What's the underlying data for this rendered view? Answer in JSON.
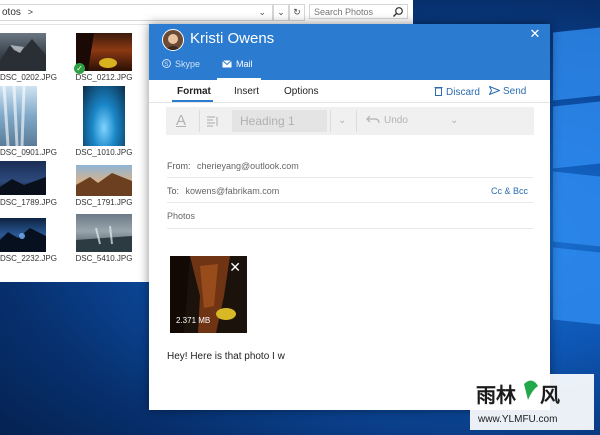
{
  "explorer": {
    "address_path": "otos",
    "search_placeholder": "Search Photos",
    "thumbnails": [
      {
        "label": "DSC_0202.JPG",
        "selected": false
      },
      {
        "label": "DSC_0212.JPG",
        "selected": true
      },
      {
        "label": "DSC_0901.JPG",
        "selected": false
      },
      {
        "label": "DSC_1010.JPG",
        "selected": false
      },
      {
        "label": "DSC_1789.JPG",
        "selected": false
      },
      {
        "label": "DSC_1791.JPG",
        "selected": false
      },
      {
        "label": "DSC_2232.JPG",
        "selected": false
      },
      {
        "label": "DSC_5410.JPG",
        "selected": false
      }
    ]
  },
  "mail": {
    "contact_name": "Kristi Owens",
    "tabs": [
      {
        "label": "Skype",
        "icon": "skype-icon"
      },
      {
        "label": "Mail",
        "icon": "mail-icon"
      }
    ],
    "ribbon_tabs": [
      "Format",
      "Insert",
      "Options"
    ],
    "discard_label": "Discard",
    "send_label": "Send",
    "toolbar": {
      "font_icon": "A",
      "style_value": "Heading 1",
      "undo_label": "Undo"
    },
    "from_label": "From:",
    "from_value": "cherieyang@outlook.com",
    "to_label": "To:",
    "to_value": "kowens@fabrikam.com",
    "cc_bcc_label": "Cc & Bcc",
    "subject": "Photos",
    "attachment_size": "2.371 MB",
    "body_text": "Hey! Here is that photo I w"
  },
  "watermark": {
    "text_cn": "雨林木风",
    "url": "www.YLMFU.com"
  },
  "colors": {
    "accent": "#2b7bd1",
    "desktop": "#0e56b4"
  }
}
